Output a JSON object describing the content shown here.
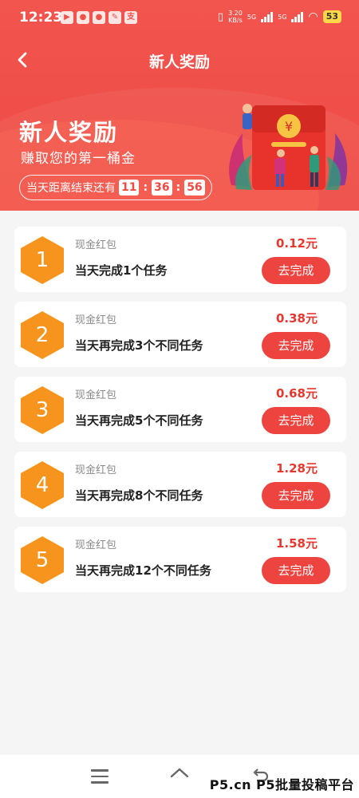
{
  "status_bar": {
    "time": "12:23",
    "net_speed": "3.20",
    "net_unit": "KB/s",
    "net_type1": "5G",
    "net_type2": "5G",
    "battery": "53"
  },
  "nav": {
    "title": "新人奖励"
  },
  "banner": {
    "title": "新人奖励",
    "subtitle": "赚取您的第一桶金",
    "countdown_label": "当天距离结束还有",
    "hours": "11",
    "minutes": "36",
    "seconds": "56",
    "separator": ":"
  },
  "tasks": [
    {
      "num": "1",
      "type": "现金红包",
      "desc": "当天完成1个任务",
      "amount": "0.12元",
      "button": "去完成"
    },
    {
      "num": "2",
      "type": "现金红包",
      "desc": "当天再完成3个不同任务",
      "amount": "0.38元",
      "button": "去完成"
    },
    {
      "num": "3",
      "type": "现金红包",
      "desc": "当天再完成5个不同任务",
      "amount": "0.68元",
      "button": "去完成"
    },
    {
      "num": "4",
      "type": "现金红包",
      "desc": "当天再完成8个不同任务",
      "amount": "1.28元",
      "button": "去完成"
    },
    {
      "num": "5",
      "type": "现金红包",
      "desc": "当天再完成12个不同任务",
      "amount": "1.58元",
      "button": "去完成"
    }
  ],
  "watermark": "P5.cn P5批量投稿平台",
  "colors": {
    "accent": "#ef4a44",
    "hex_orange": "#f7941d",
    "amount_red": "#e8372f"
  }
}
